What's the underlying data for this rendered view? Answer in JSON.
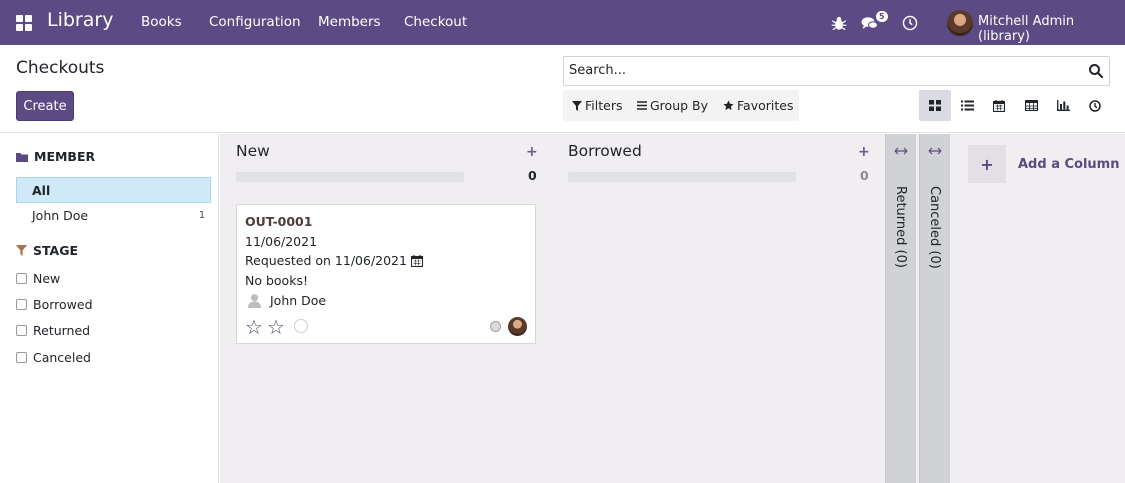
{
  "navbar": {
    "brand": "Library",
    "menu": [
      "Books",
      "Configuration",
      "Members",
      "Checkout"
    ],
    "messages_badge": "5",
    "user": "Mitchell Admin (library)",
    "bg_color": "#5b4a83",
    "icons": [
      "apps-icon",
      "bug-icon",
      "chat-icon",
      "clock-icon"
    ]
  },
  "control_panel": {
    "title": "Checkouts",
    "create_label": "Create",
    "search_placeholder": "Search...",
    "filters_label": "Filters",
    "group_by_label": "Group By",
    "favorites_label": "Favorites",
    "views": [
      "kanban",
      "list",
      "calendar",
      "pivot",
      "graph",
      "activity"
    ],
    "active_view": "kanban"
  },
  "sidebar": {
    "member_header": "MEMBER",
    "member_all": "All",
    "members": [
      {
        "name": "John Doe",
        "count": "1"
      }
    ],
    "stage_header": "STAGE",
    "stages": [
      "New",
      "Borrowed",
      "Returned",
      "Canceled"
    ]
  },
  "kanban": {
    "columns": [
      {
        "title": "New",
        "count": "0"
      },
      {
        "title": "Borrowed",
        "count": "0"
      }
    ],
    "folded_columns": [
      "Returned (0)",
      "Canceled (0)"
    ],
    "add_column_label": "Add a Column",
    "card": {
      "ref": "OUT-0001",
      "date": "11/06/2021",
      "requested": "Requested on 11/06/2021",
      "note": "No books!",
      "member": "John Doe",
      "priority_stars": 2
    }
  }
}
